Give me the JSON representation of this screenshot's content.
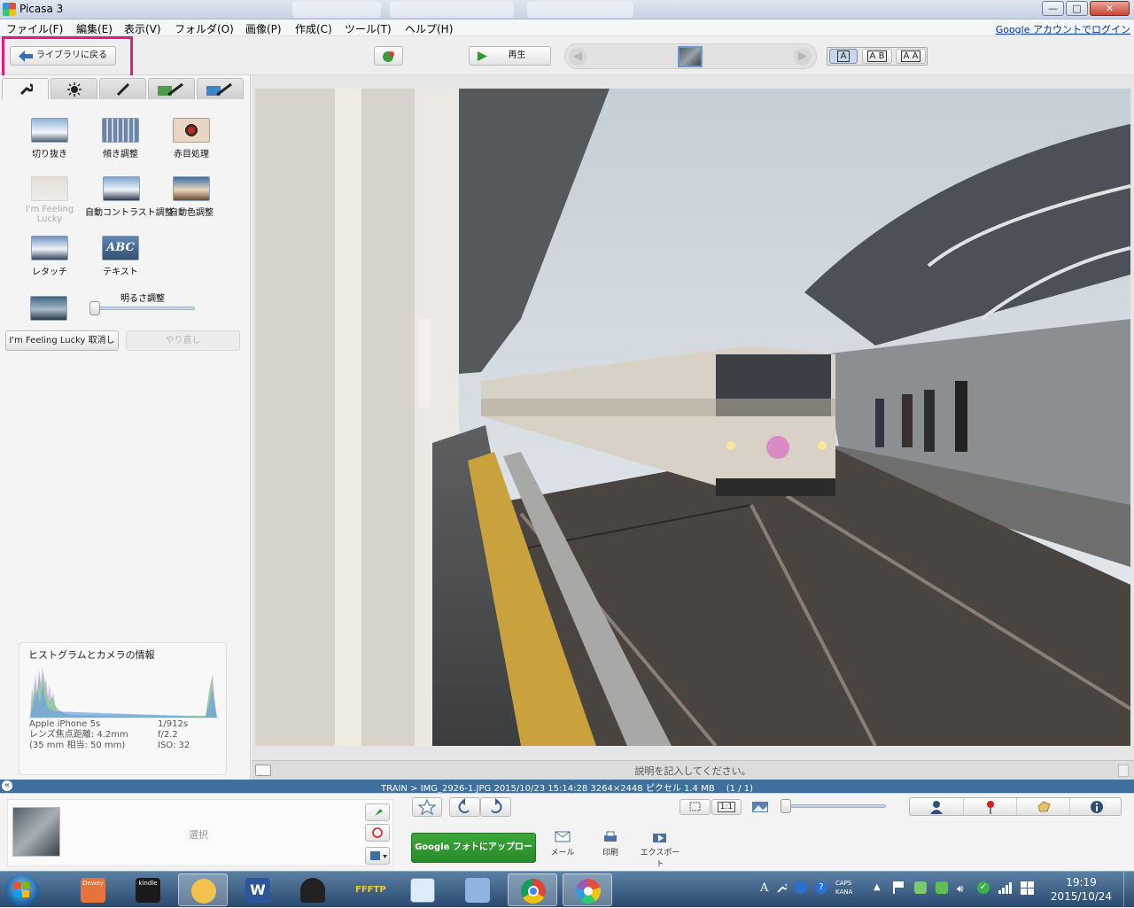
{
  "window": {
    "title": "Picasa 3",
    "controls": {
      "minimize": "—",
      "maximize": "□",
      "close": "✕"
    }
  },
  "menu": {
    "items": [
      "ファイル(F)",
      "編集(E)",
      "表示(V)",
      "フォルダ(O)",
      "画像(P)",
      "作成(C)",
      "ツール(T)",
      "ヘルプ(H)"
    ],
    "login_link": "Google アカウントでログイン"
  },
  "toolbar": {
    "back_label": "ライブラリに戻る",
    "play_label": "再生",
    "view_a": "A",
    "view_ab": "A B",
    "view_aa": "A A"
  },
  "edit_panel": {
    "tools": [
      {
        "label": "切り抜き",
        "icon": "crop-icon",
        "enabled": true
      },
      {
        "label": "傾き調整",
        "icon": "straighten-icon",
        "enabled": true
      },
      {
        "label": "赤目処理",
        "icon": "redeye-icon",
        "enabled": true
      },
      {
        "label": "I'm Feeling Lucky",
        "icon": "lucky-icon",
        "enabled": false
      },
      {
        "label": "自動コントラスト調整",
        "icon": "auto-contrast-icon",
        "enabled": true
      },
      {
        "label": "自動色調整",
        "icon": "auto-color-icon",
        "enabled": true
      },
      {
        "label": "レタッチ",
        "icon": "retouch-icon",
        "enabled": true
      },
      {
        "label": "テキスト",
        "icon": "text-icon",
        "enabled": true
      }
    ],
    "text_icon_glyph": "ABC",
    "brightness_label": "明るさ調整",
    "brightness_level": 0.0,
    "undo_label": "I'm Feeling Lucky 取消し",
    "redo_label": "やり直し"
  },
  "histogram": {
    "title": "ヒストグラムとカメラの情報",
    "camera": "Apple iPhone 5s",
    "focal": "レンズ焦点距離: 4.2mm",
    "focal35": "(35 mm 相当:  50 mm)",
    "shutter": "1/912s",
    "aperture": "f/2.2",
    "iso": "ISO: 32"
  },
  "caption": {
    "placeholder": "説明を記入してください。"
  },
  "status": {
    "collapse_glyph": "«",
    "path": "TRAIN > IMG_2926-1.JPG   2015/10/23 15:14:28   3264×2448 ピクセル   1.4 MB",
    "counter": "(1 / 1)"
  },
  "bottom": {
    "selection_label": "選択",
    "upload_label": "Google フォトにアップロード",
    "mail_label": "メール",
    "print_label": "印刷",
    "export_label": "エクスポート",
    "zoom_level": 0.0,
    "actual_size_label": "1:1"
  },
  "taskbar": {
    "apps": [
      "dewey-icon",
      "kindle-icon",
      "smile-icon",
      "word-icon",
      "inkscape-icon",
      "ftp-icon",
      "paint-icon",
      "notepad-icon",
      "chrome-icon",
      "picasa-icon"
    ],
    "dewey_label": "Dewey",
    "kindle_label": "kindle",
    "word_label": "W",
    "ftp_label": "FFFTP",
    "ime_mode": "A",
    "caps": "CAPS",
    "kana": "KANA",
    "time": "19:19",
    "date": "2015/10/24"
  },
  "colors": {
    "highlight": "#e6197f",
    "status_bar": "#3f6f9d",
    "upload_green": "#2f9a2f"
  }
}
